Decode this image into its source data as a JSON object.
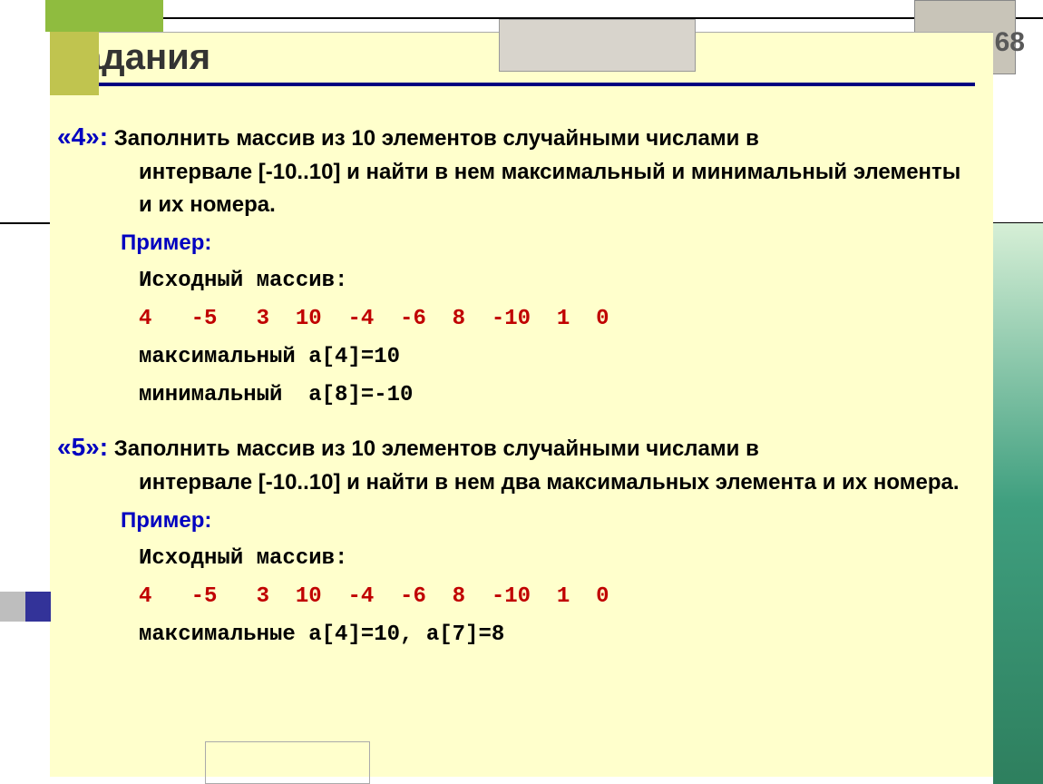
{
  "page_number": "68",
  "title": "Задания",
  "task4": {
    "num": "«4»:",
    "lead": "Заполнить массив из 10 элементов случайными числами в",
    "rest": "интервале [-10..10] и найти в нем максимальный и минимальный элементы и их номера.",
    "example_label": "Пример:",
    "src_label": "Исходный массив:",
    "array": "4   -5   3  10  -4  -6  8  -10  1  0",
    "max_line": "максимальный a[4]=10",
    "min_line": "минимальный  a[8]=-10"
  },
  "task5": {
    "num": "«5»:",
    "lead": "Заполнить массив из 10 элементов случайными числами в",
    "rest": "интервале [-10..10] и найти в нем два максимальных элемента и их номера.",
    "example_label": "Пример:",
    "src_label": "Исходный массив:",
    "array": "4   -5   3  10  -4  -6  8  -10  1  0",
    "max_line": "максимальные a[4]=10, a[7]=8"
  }
}
